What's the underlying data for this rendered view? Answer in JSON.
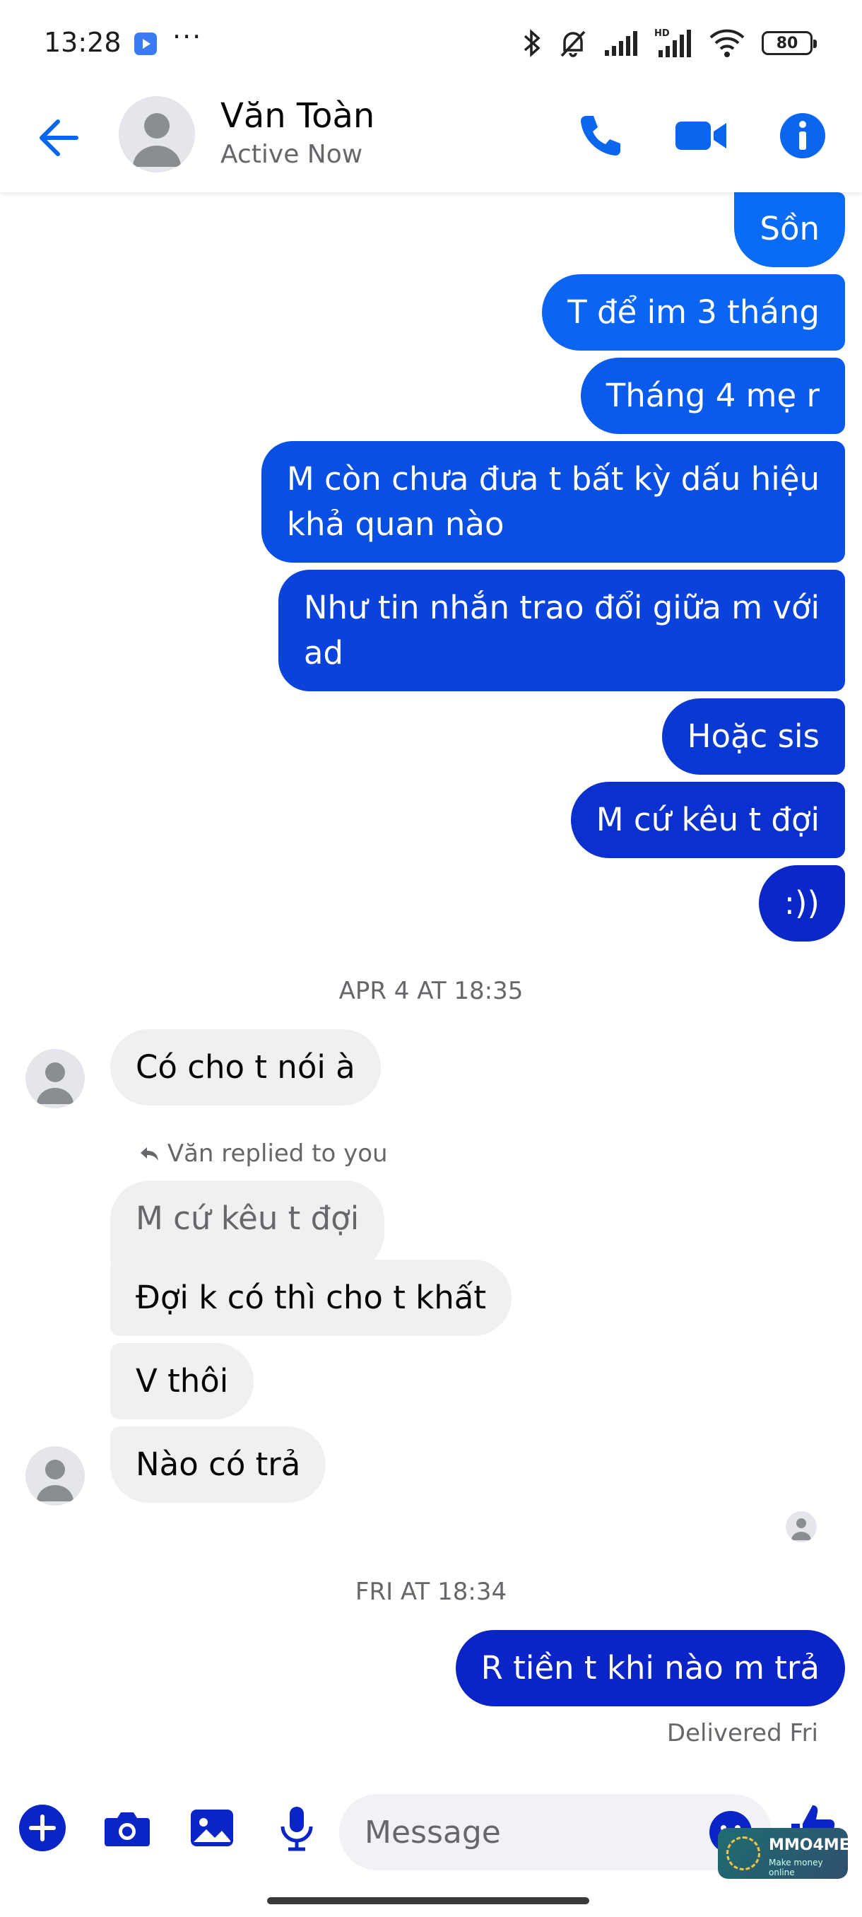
{
  "status_bar": {
    "time": "13:28",
    "battery": "80"
  },
  "header": {
    "name": "Văn Toàn",
    "status": "Active Now"
  },
  "colors": {
    "accent": "#0a66ef",
    "bubble_out_light": "#0a6cf5",
    "bubble_out_dark": "#0a24c8",
    "bubble_in": "#f0f0f0"
  },
  "messages_sent_1": [
    {
      "lines": [
        "Sồn"
      ]
    },
    {
      "lines": [
        "T để im 3 tháng"
      ]
    },
    {
      "lines": [
        "Tháng 4  mẹ r"
      ]
    },
    {
      "lines": [
        "M còn chưa đưa t bất kỳ dấu hiệu",
        "khả quan nào"
      ]
    },
    {
      "lines": [
        "Như tin nhắn trao đổi giữa m với",
        "ad"
      ]
    },
    {
      "lines": [
        "Hoặc sis"
      ]
    },
    {
      "lines": [
        "M cứ kêu t đợi"
      ]
    },
    {
      "lines": [
        ":))"
      ]
    }
  ],
  "timestamp_1": "APR 4 AT 18:35",
  "received_1": "Có cho t nói à",
  "reply_label": "Văn replied to you",
  "reply_quote": "M cứ kêu t đợi",
  "received_2": [
    "Đợi k có thì cho t khất",
    "V thôi",
    "Nào có trả"
  ],
  "timestamp_2": "FRI AT 18:34",
  "sent_last": "R tiền t khi nào m trả",
  "delivered_label": "Delivered Fri",
  "composer": {
    "placeholder": "Message"
  },
  "watermark": {
    "title": "MMO4ME",
    "subtitle": "Make money online"
  }
}
